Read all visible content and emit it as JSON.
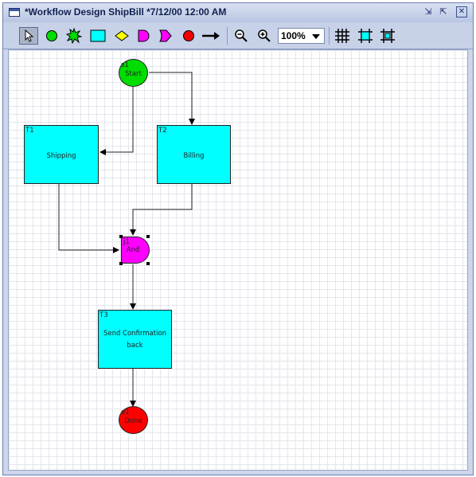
{
  "window": {
    "title": "*Workflow Design ShipBill *7/12/00 12:00 AM",
    "buttons": {
      "minimize": "⇲",
      "maximize": "⇱",
      "close": "✕"
    }
  },
  "toolbar": {
    "tools": [
      {
        "name": "select",
        "selected": true
      },
      {
        "name": "start-node"
      },
      {
        "name": "star-node"
      },
      {
        "name": "task-node"
      },
      {
        "name": "decision-node"
      },
      {
        "name": "and-node"
      },
      {
        "name": "or-node"
      },
      {
        "name": "end-node"
      },
      {
        "name": "connector"
      }
    ],
    "zoom_value": "100%"
  },
  "diagram": {
    "nodes": [
      {
        "id": "S1",
        "label": "Start",
        "shape": "circle",
        "color": "#00dd00"
      },
      {
        "id": "T1",
        "label": "Shipping",
        "shape": "task",
        "color": "#00ffff"
      },
      {
        "id": "T2",
        "label": "Billing",
        "shape": "task",
        "color": "#00ffff"
      },
      {
        "id": "J1",
        "label": "And",
        "shape": "and",
        "color": "#ff00ff",
        "selected": true
      },
      {
        "id": "T3",
        "label": "Send Confirmation back",
        "shape": "task",
        "color": "#00ffff"
      },
      {
        "id": "E1",
        "label": "Done",
        "shape": "circle",
        "color": "#ff0000"
      }
    ],
    "edges": [
      {
        "from": "S1",
        "to": "T1"
      },
      {
        "from": "S1",
        "to": "T2"
      },
      {
        "from": "T1",
        "to": "J1"
      },
      {
        "from": "T2",
        "to": "J1"
      },
      {
        "from": "J1",
        "to": "T3"
      },
      {
        "from": "T3",
        "to": "E1"
      }
    ],
    "start": {
      "id": "s1",
      "label": "Start"
    },
    "t1": {
      "id": "T1",
      "label": "Shipping"
    },
    "t2": {
      "id": "T2",
      "label": "Billing"
    },
    "and": {
      "id": "j1",
      "label": "And"
    },
    "t3": {
      "id": "T3",
      "label_line1": "Send Confirmation",
      "label_line2": "back"
    },
    "done": {
      "id": "e1",
      "label": "Done"
    }
  }
}
